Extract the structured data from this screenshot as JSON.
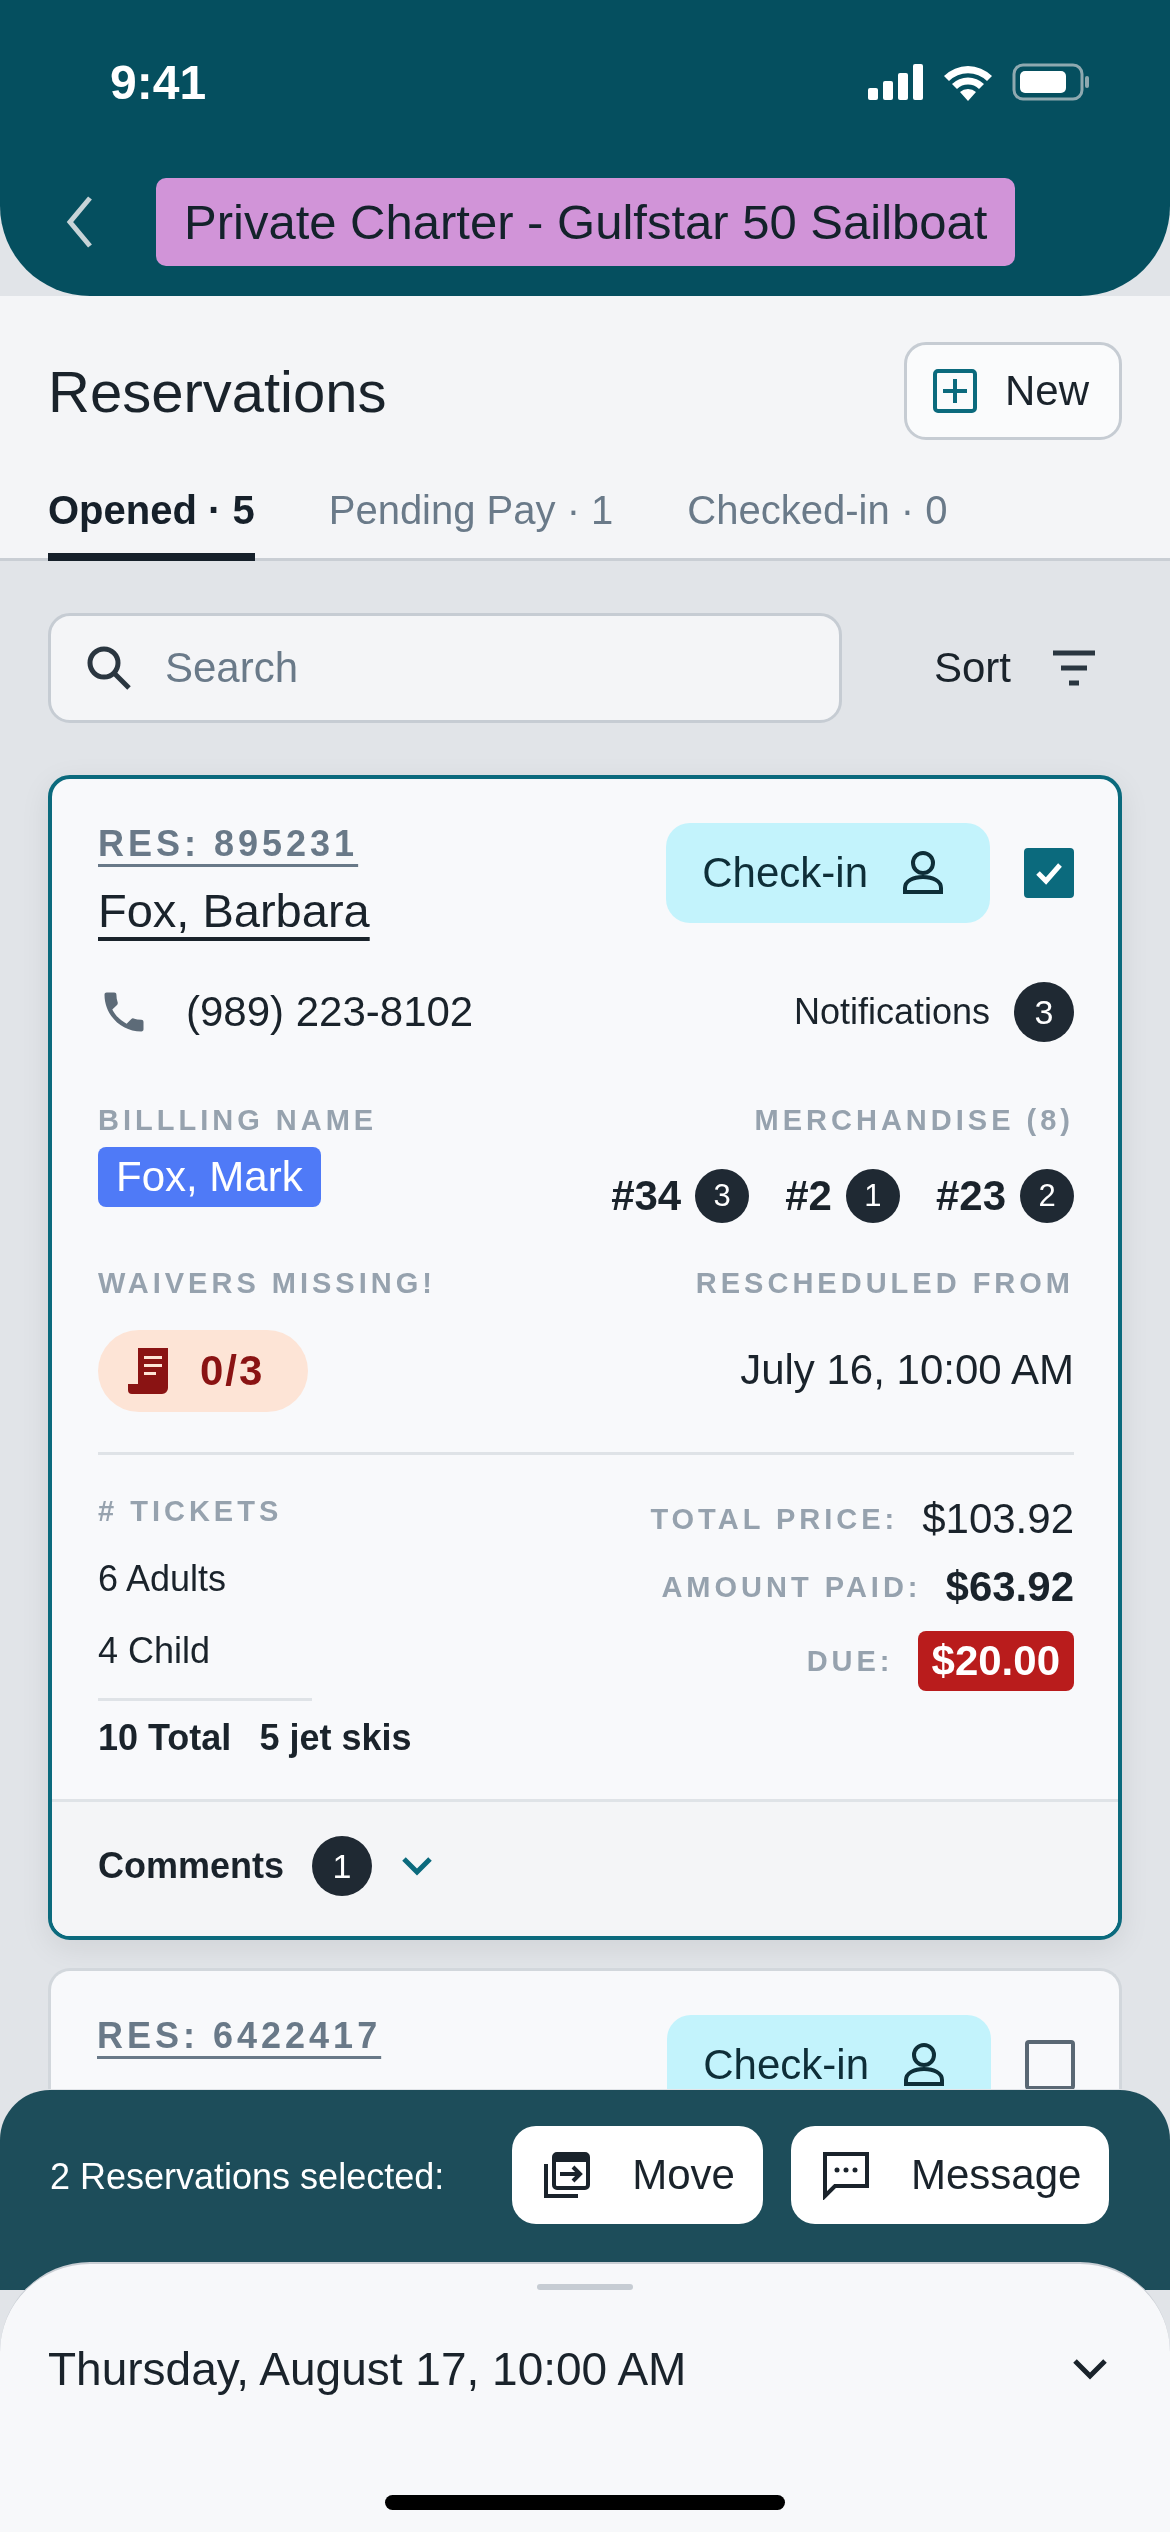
{
  "status_bar": {
    "time": "9:41"
  },
  "header": {
    "title": "Private Charter - Gulfstar 50 Sailboat"
  },
  "page": {
    "title": "Reservations",
    "new_button": "New"
  },
  "tabs": [
    {
      "label": "Opened · 5",
      "selected": true
    },
    {
      "label": "Pending Pay · 1",
      "selected": false
    },
    {
      "label": "Checked-in · 0",
      "selected": false
    }
  ],
  "search": {
    "placeholder": "Search"
  },
  "sort": {
    "label": "Sort"
  },
  "reservations": [
    {
      "res": "RES: 895231",
      "name": "Fox, Barbara",
      "check_in": "Check-in",
      "selected": true,
      "phone": "(989) 223-8102",
      "notifications": {
        "label": "Notifications",
        "count": "3"
      },
      "billing": {
        "label": "BILLLING NAME",
        "name": "Fox, Mark"
      },
      "merchandise": {
        "label": "MERCHANDISE (8)",
        "items": [
          {
            "code": "#34",
            "count": "3"
          },
          {
            "code": "#2",
            "count": "1"
          },
          {
            "code": "#23",
            "count": "2"
          }
        ]
      },
      "waivers": {
        "label": "WAIVERS MISSING!",
        "value": "0/3"
      },
      "rescheduled": {
        "label": "RESCHEDULED FROM",
        "value": "July 16, 10:00 AM"
      },
      "tickets": {
        "label": "# TICKETS",
        "lines": [
          "6 Adults",
          "4 Child"
        ],
        "total": "10 Total",
        "extra": "5 jet skis"
      },
      "prices": [
        {
          "label": "TOTAL PRICE:",
          "value": "$103.92",
          "kind": "plain"
        },
        {
          "label": "AMOUNT PAID:",
          "value": "$63.92",
          "kind": "bold"
        },
        {
          "label": "DUE:",
          "value": "$20.00",
          "kind": "due"
        }
      ],
      "comments": {
        "label": "Comments",
        "count": "1"
      }
    },
    {
      "res": "RES: 6422417",
      "check_in": "Check-in",
      "selected": false
    }
  ],
  "selection_bar": {
    "text": "2 Reservations selected:",
    "buttons": [
      {
        "label": "Move",
        "kind": "move"
      },
      {
        "label": "Message",
        "kind": "message"
      }
    ]
  },
  "date_sheet": {
    "date": "Thursday, August 17, 10:00 AM"
  }
}
